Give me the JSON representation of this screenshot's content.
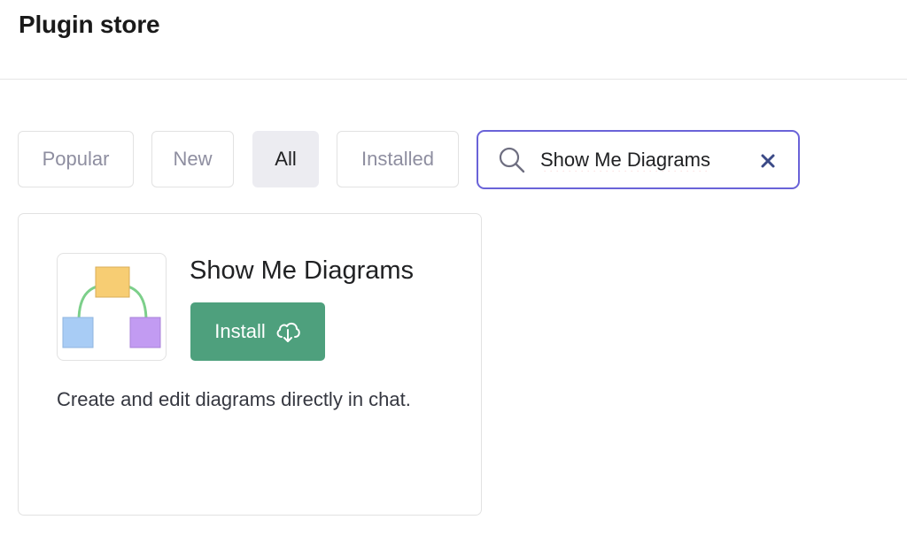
{
  "header": {
    "title": "Plugin store"
  },
  "tabs": [
    {
      "label": "Popular",
      "active": false
    },
    {
      "label": "New",
      "active": false
    },
    {
      "label": "All",
      "active": true
    },
    {
      "label": "Installed",
      "active": false
    }
  ],
  "search": {
    "value": "Show Me Diagrams",
    "icon": "search-icon",
    "clear_icon": "close-icon"
  },
  "plugin": {
    "name": "Show Me Diagrams",
    "install_label": "Install",
    "install_icon": "cloud-download-icon",
    "description": "Create and edit diagrams directly in chat.",
    "logo_colors": {
      "top": "#f7cd73",
      "left": "#a8ccf5",
      "right": "#c29bf2",
      "connector": "#7ccf8a"
    }
  },
  "colors": {
    "accent": "#6a63d8",
    "install": "#4ea07d",
    "active_tab": "#ececf1"
  }
}
